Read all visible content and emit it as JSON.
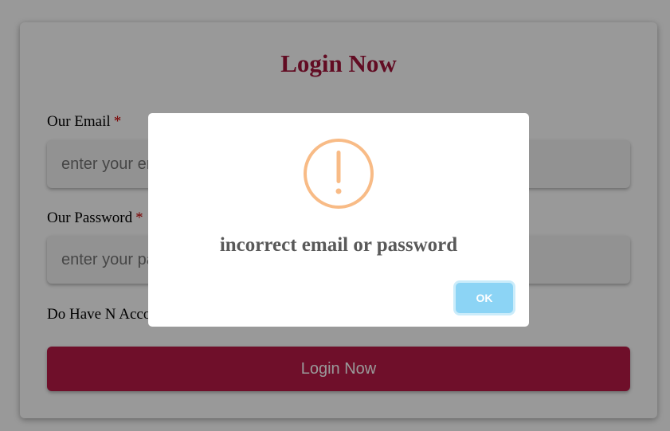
{
  "login": {
    "title": "Login Now",
    "email_label": "Our Email",
    "email_placeholder": "enter your email",
    "password_label": "Our Password",
    "password_placeholder": "enter your password",
    "required_mark": "*",
    "account_text": "Do Have N Account? Register Now",
    "submit_label": "Login Now"
  },
  "alert": {
    "icon": "warning-icon",
    "message": "incorrect email or password",
    "ok_label": "OK"
  },
  "colors": {
    "brand": "#b91a47",
    "title": "#a3153b",
    "warning": "#f8bb86",
    "ok_button": "#8cd4f5",
    "required": "#cc0000"
  }
}
